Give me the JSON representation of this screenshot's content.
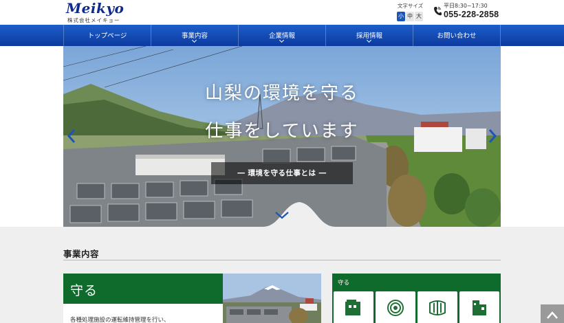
{
  "header": {
    "logo_main": "Meikyo",
    "logo_sub": "株式会社メイキョー",
    "font_size_label": "文字サイズ",
    "font_size_options": [
      "小",
      "中",
      "大"
    ],
    "font_size_selected": "小",
    "hours": "平日8:30~17:30",
    "phone": "055-228-2858"
  },
  "nav": {
    "items": [
      {
        "label": "トップページ",
        "has_submenu": false
      },
      {
        "label": "事業内容",
        "has_submenu": true
      },
      {
        "label": "企業情報",
        "has_submenu": true
      },
      {
        "label": "採用情報",
        "has_submenu": true
      },
      {
        "label": "お問い合わせ",
        "has_submenu": false
      }
    ]
  },
  "hero": {
    "headline_1": "山梨の環境を守る",
    "headline_2": "仕事をしています",
    "cta": "―  環境を守る仕事とは  ―"
  },
  "section": {
    "title": "事業内容"
  },
  "card": {
    "heading": "守る",
    "text": "各種処理施設の運転維持管理を行い、"
  },
  "panel": {
    "title": "守る",
    "icons": [
      "building-icon",
      "water-pipe-icon",
      "sewer-pipe-icon",
      "facility-icon"
    ]
  },
  "colors": {
    "nav_blue": "#0c3a9e",
    "logo_blue": "#0f2a8c",
    "green": "#0e6b2b",
    "gray_bg": "#efefef"
  }
}
